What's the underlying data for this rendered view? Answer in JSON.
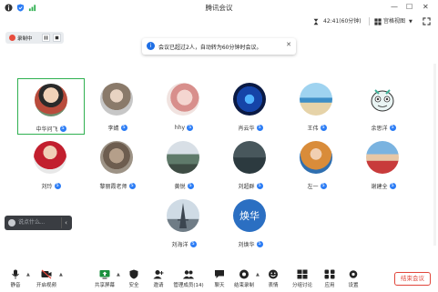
{
  "window": {
    "title": "腾讯会议"
  },
  "toolbar": {
    "time_label": "42:41(60分钟)",
    "view_label": "宫格视图"
  },
  "recording": {
    "label": "录制中"
  },
  "toast": {
    "message": "会议已超过2人，自动转为60分钟时会议。"
  },
  "participants": [
    {
      "name": "中华问飞",
      "active": true
    },
    {
      "name": "李婧"
    },
    {
      "name": "hhy"
    },
    {
      "name": "肖云华"
    },
    {
      "name": "王伟"
    },
    {
      "name": "余思洋"
    },
    {
      "name": "刘玲"
    },
    {
      "name": "黎丽霞老师"
    },
    {
      "name": "黄锐"
    },
    {
      "name": "刘超群"
    },
    {
      "name": "左一"
    },
    {
      "name": "谢建全"
    },
    {
      "name": "刘海洋"
    },
    {
      "name": "刘焕华",
      "avatar_text": "焕华"
    }
  ],
  "chat": {
    "placeholder": "说点什么..."
  },
  "bottom_toolbar": {
    "mute": "静音",
    "video": "开启视频",
    "share": "共享屏幕",
    "security": "安全",
    "invite": "邀请",
    "members": "管理成员(14)",
    "chat": "聊天",
    "record": "结束录制",
    "react": "表情",
    "breakout": "分组讨论",
    "apps": "应用",
    "settings": "设置",
    "end": "结束会议"
  },
  "colors": {
    "accent": "#2b7cf5",
    "end_red": "#e0453a",
    "active_border": "#2fb050"
  }
}
